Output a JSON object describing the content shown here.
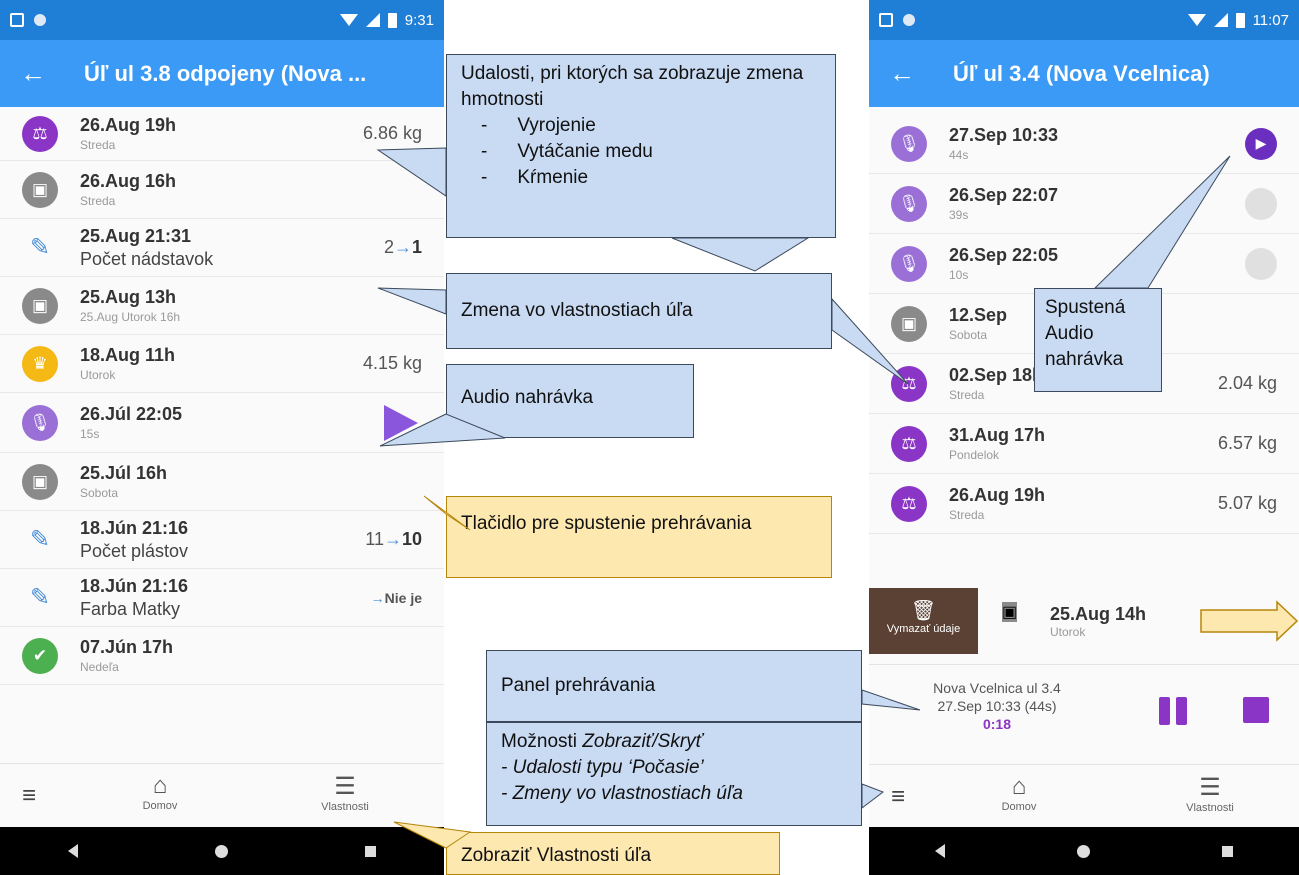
{
  "left_phone": {
    "status_time": "9:31",
    "title": "Úľ ul 3.8 odpojeny (Nova ...",
    "rows": [
      {
        "date": "26.Aug  19h",
        "sub": "Streda",
        "value": "6.86 kg",
        "icon": "scale-icon"
      },
      {
        "date": "26.Aug  16h",
        "sub": "Streda",
        "value": "",
        "icon": "hive-icon"
      },
      {
        "date": "25.Aug 21:31",
        "sub": "Počet nádstavok",
        "value_from": "2",
        "value_to": "1",
        "icon": "edit-icon"
      },
      {
        "date": "25.Aug  13h",
        "sub": "25.Aug Utorok 16h",
        "value": "",
        "icon": "hive-icon"
      },
      {
        "date": "18.Aug  11h",
        "sub": "Utorok",
        "value": "4.15 kg",
        "icon": "honey-icon"
      },
      {
        "date": "26.Júl  22:05",
        "sub": "15s",
        "value": "",
        "icon": "microphone-icon"
      },
      {
        "date": "25.Júl  16h",
        "sub": "Sobota",
        "value": "",
        "icon": "hive-icon"
      },
      {
        "date": "18.Jún 21:16",
        "sub": "Počet plástov",
        "value_from": "11",
        "value_to": "10",
        "icon": "edit-icon"
      },
      {
        "date": "18.Jún 21:16",
        "sub": "Farba Matky",
        "value_from": "",
        "value_to": "Nie je",
        "icon": "edit-icon"
      },
      {
        "date": "07.Jún  17h",
        "sub": "Nedeľa",
        "value": "",
        "icon": "check-icon"
      }
    ],
    "nav": {
      "home": "Domov",
      "props": "Vlastnosti"
    }
  },
  "right_phone": {
    "status_time": "11:07",
    "title": "Úľ ul 3.4 (Nova Vcelnica)",
    "rows": [
      {
        "date": "27.Sep 10:33",
        "sub": "44s",
        "value": ""
      },
      {
        "date": "26.Sep 22:07",
        "sub": "39s",
        "value": ""
      },
      {
        "date": "26.Sep 22:05",
        "sub": "10s",
        "value": ""
      },
      {
        "date": "12.Sep",
        "sub": "Sobota",
        "value": ""
      },
      {
        "date": "02.Sep  18h",
        "sub": "Streda",
        "value": "2.04 kg"
      },
      {
        "date": "31.Aug  17h",
        "sub": "Pondelok",
        "value": "6.57 kg"
      },
      {
        "date": "26.Aug  19h",
        "sub": "Streda",
        "value": "5.07 kg"
      }
    ],
    "swipe": {
      "delete_label": "Vymazať údaje",
      "date": "25.Aug  14h",
      "sub": "Utorok"
    },
    "player": {
      "line1": "Nova Vcelnica ul 3.4",
      "line2": "27.Sep 10:33 (44s)",
      "time": "0:18"
    },
    "nav": {
      "home": "Domov",
      "props": "Vlastnosti"
    }
  },
  "callouts": {
    "events_title": "Udalosti, pri ktorých sa zobrazuje zmena hmotnosti",
    "events_items": [
      "Vyrojenie",
      "Vytáčanie medu",
      "Kŕmenie"
    ],
    "property_change": "Zmena vo vlastnostiach úľa",
    "audio_recording": "Audio nahrávka",
    "play_button": "Tlačidlo pre spustenie prehrávania",
    "running_audio": "Spustená Audio nahrávka",
    "player_panel": "Panel prehrávania",
    "options_title": "Možnosti",
    "options_em": "Zobraziť/Skryť",
    "options_line1": "- Udalosti typu ‘Počasie’",
    "options_line2": "- Zmeny vo vlastnostiach úľa",
    "show_props": "Zobraziť Vlastnosti úľa"
  }
}
